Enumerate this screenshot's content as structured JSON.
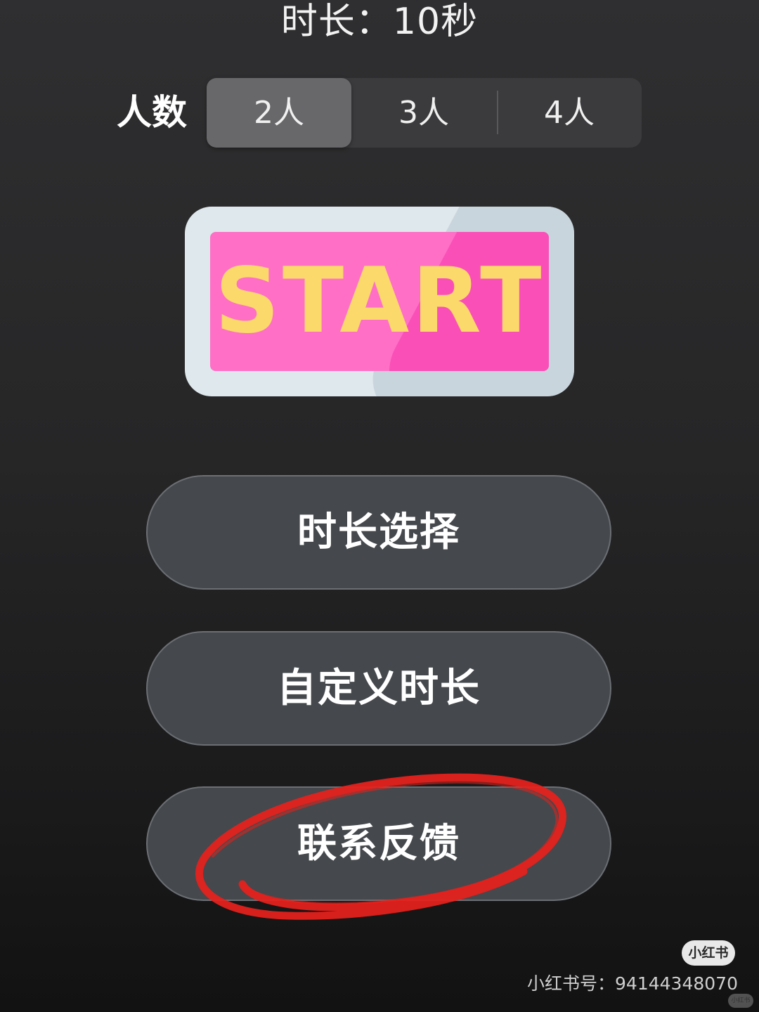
{
  "header": {
    "duration_text": "时长：10秒"
  },
  "players": {
    "label": "人数",
    "options": [
      "2人",
      "3人",
      "4人"
    ],
    "selected_index": 0
  },
  "start_button": {
    "label": "START"
  },
  "menu": {
    "duration_select": "时长选择",
    "custom_duration": "自定义时长",
    "feedback": "联系反馈"
  },
  "annotation": {
    "color": "#e8211c",
    "target": "feedback"
  },
  "watermark": {
    "brand": "小红书",
    "account_id": "小红书号：94144348070",
    "mini_brand": "小红书"
  },
  "colors": {
    "start_face": "#ff6fc6",
    "start_text": "#fbd96b",
    "button_bg": "#45484c"
  }
}
